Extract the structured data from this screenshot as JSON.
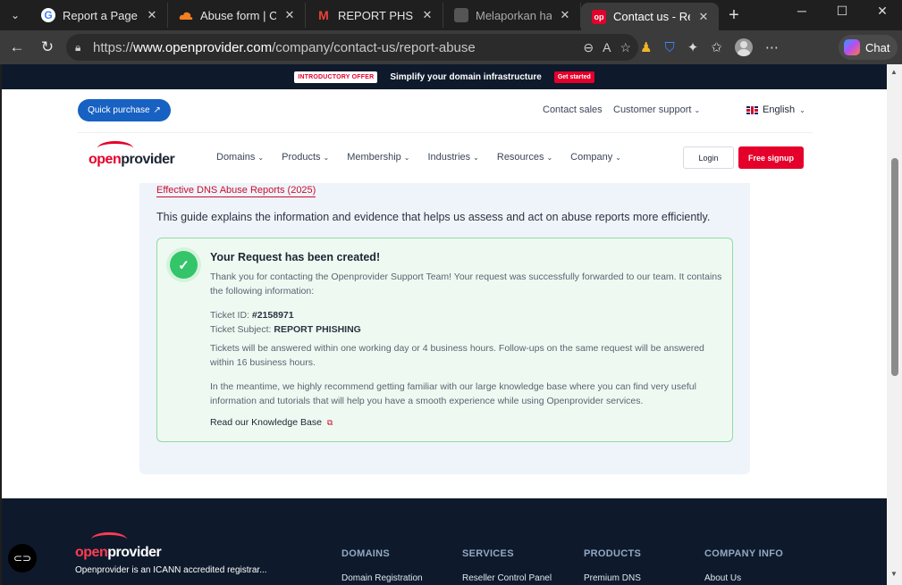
{
  "browser": {
    "tabs": [
      {
        "title": "Report a Page to Google",
        "favicon": "google-icon"
      },
      {
        "title": "Abuse form | Cloudflare",
        "favicon": "cloud-icon"
      },
      {
        "title": "REPORT PHSIHING",
        "favicon": "gmail-icon"
      },
      {
        "title": "Melaporkan halaman",
        "favicon": "doc-icon"
      },
      {
        "title": "Contact us - Report abuse",
        "favicon": "openprovider-icon"
      }
    ],
    "new_tab": "+",
    "url_prefix": "https://",
    "url_host": "www.openprovider.com",
    "url_path": "/company/contact-us/report-abuse",
    "chat_label": "Chat",
    "colors": {
      "chrome": "#1f1f1f",
      "toolbar": "#3b3b3b"
    }
  },
  "promo": {
    "badge": "INTRODUCTORY OFFER",
    "text": "Simplify your domain infrastructure",
    "cta": "Get started"
  },
  "header": {
    "quick_purchase": "Quick purchase",
    "contact_sales": "Contact sales",
    "customer_support": "Customer support",
    "language": "English",
    "logo_a": "open",
    "logo_b": "provider",
    "nav": [
      "Domains",
      "Products",
      "Membership",
      "Industries",
      "Resources",
      "Company"
    ],
    "login": "Login",
    "signup": "Free signup"
  },
  "content": {
    "guide_link": "Effective DNS Abuse Reports (2025)",
    "guide_text": "This guide explains the information and evidence that helps us assess and act on abuse reports more efficiently.",
    "card": {
      "title": "Your Request has been created!",
      "p1": "Thank you for contacting the Openprovider Support Team! Your request was successfully forwarded to our team. It contains the following information:",
      "ticket_id_label": "Ticket ID:",
      "ticket_id": "#2158971",
      "ticket_subject_label": "Ticket Subject:",
      "ticket_subject": "REPORT PHISHING",
      "p2": "Tickets will be answered within one working day or 4 business hours. Follow-ups on the same request will be answered within 16 business hours.",
      "p3": "In the meantime, we highly recommend getting familiar with our large knowledge base where you can find very useful information and tutorials that will help you have a smooth experience while using Openprovider services.",
      "kb_link": "Read our Knowledge Base"
    }
  },
  "footer": {
    "tagline": "Openprovider is an ICANN accredited registrar...",
    "columns": [
      "DOMAINS",
      "SERVICES",
      "PRODUCTS",
      "COMPANY INFO"
    ],
    "column_items": [
      "Domain Registration",
      "Reseller Control Panel",
      "Premium DNS",
      "About Us"
    ]
  },
  "colors": {
    "brand_red": "#e4002b",
    "brand_blue": "#1761c2",
    "success_green": "#34c46a",
    "navy": "#0e1a2b"
  }
}
